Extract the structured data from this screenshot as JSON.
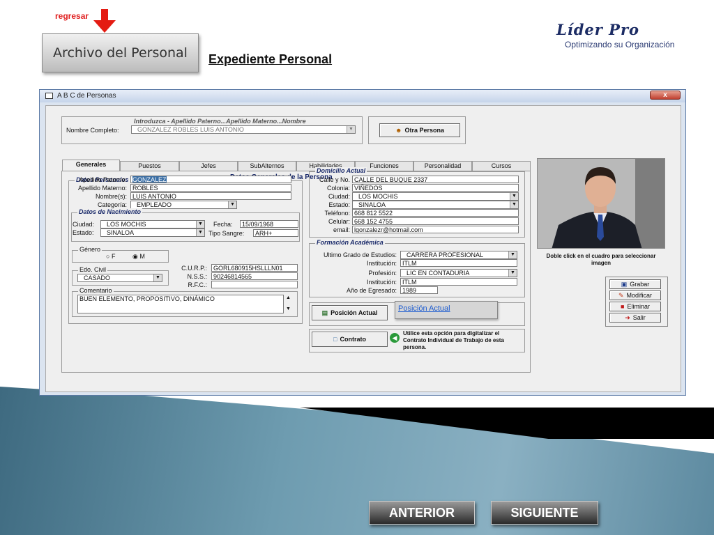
{
  "slide": {
    "back_link": "regresar",
    "section_button": "Archivo del Personal",
    "heading": "Expediente Personal",
    "logo": {
      "name": "Líder Pro",
      "tagline": "Optimizando su Organización"
    },
    "nav": {
      "prev": "ANTERIOR",
      "next": "SIGUIENTE"
    }
  },
  "window": {
    "title": "A B C de Personas",
    "close": "x",
    "search_hint": "Introduzca - Apellido Paterno...Apellido Materno...Nombre",
    "full_name_label": "Nombre Completo:",
    "full_name_value": "GONZALEZ ROBLES LUIS ANTONIO",
    "otra_persona": "Otra Persona",
    "tabs": [
      "Generales",
      "Puestos",
      "Jefes",
      "SubAlternos",
      "Habilidades",
      "Funciones",
      "Personalidad",
      "Cursos"
    ],
    "panel_title": "Datos Generales de la Persona",
    "datos_personales": {
      "title": "Datos Personales",
      "apellido_paterno_label": "Apellido Paterno:",
      "apellido_paterno": "GONZALEZ",
      "apellido_materno_label": "Apellido Materno:",
      "apellido_materno": "ROBLES",
      "nombres_label": "Nombre(s):",
      "nombres": "LUIS ANTONIO",
      "categoria_label": "Categoría:",
      "categoria": "EMPLEADO"
    },
    "nacimiento": {
      "title": "Datos de Nacimiento",
      "ciudad_label": "Ciudad:",
      "ciudad": "LOS MOCHIS",
      "estado_label": "Estado:",
      "estado": "SINALOA",
      "fecha_label": "Fecha:",
      "fecha": "15/09/1968",
      "sangre_label": "Tipo Sangre:",
      "sangre": "ARH+"
    },
    "genero": {
      "title": "Género",
      "f": "F",
      "m": "M"
    },
    "civil": {
      "title": "Edo. Civil",
      "value": "CASADO"
    },
    "ids": {
      "curp_label": "C.U.R.P.:",
      "curp": "GORL680915HSLLLN01",
      "nss_label": "N.S.S.:",
      "nss": "90246814565",
      "rfc_label": "R.F.C.:",
      "rfc": ""
    },
    "comentario": {
      "title": "Comentario",
      "value": "BUEN ELEMENTO, PROPOSITIVO, DINÁMICO"
    },
    "domicilio": {
      "title": "Domicilio Actual",
      "calle_label": "Calle y No.",
      "calle": "CALLE DEL BUQUE 2337",
      "colonia_label": "Colonia:",
      "colonia": "VIÑEDOS",
      "ciudad_label": "Ciudad:",
      "ciudad": "LOS MOCHIS",
      "estado_label": "Estado:",
      "estado": "SINALOA",
      "telefono_label": "Teléfono:",
      "telefono": "668 812 5522",
      "celular_label": "Celular:",
      "celular": "668 152 4755",
      "email_label": "email:",
      "email": "lgonzalezr@hotmail.com"
    },
    "academica": {
      "title": "Formación Académica",
      "grado_label": "Ultimo Grado de Estudios:",
      "grado": "CARRERA PROFESIONAL",
      "inst1_label": "Institución:",
      "inst1": "ITLM",
      "profesion_label": "Profesión:",
      "profesion": "LIC EN CONTADURIA",
      "inst2_label": "Institución:",
      "inst2": "ITLM",
      "egreso_label": "Año de Egresado:",
      "egreso": "1989"
    },
    "posicion_btn": "Posición Actual",
    "posicion_link": "Posición Actual",
    "contrato_btn": "Contrato",
    "contrato_note": "Utilice esta opción para digitalizar el Contrato Individual de Trabajo de esta persona.",
    "photo_caption": "Doble click en el cuadro para seleccionar imagen",
    "actions": [
      "Grabar",
      "Modificar",
      "Eliminar",
      "Salir"
    ]
  }
}
